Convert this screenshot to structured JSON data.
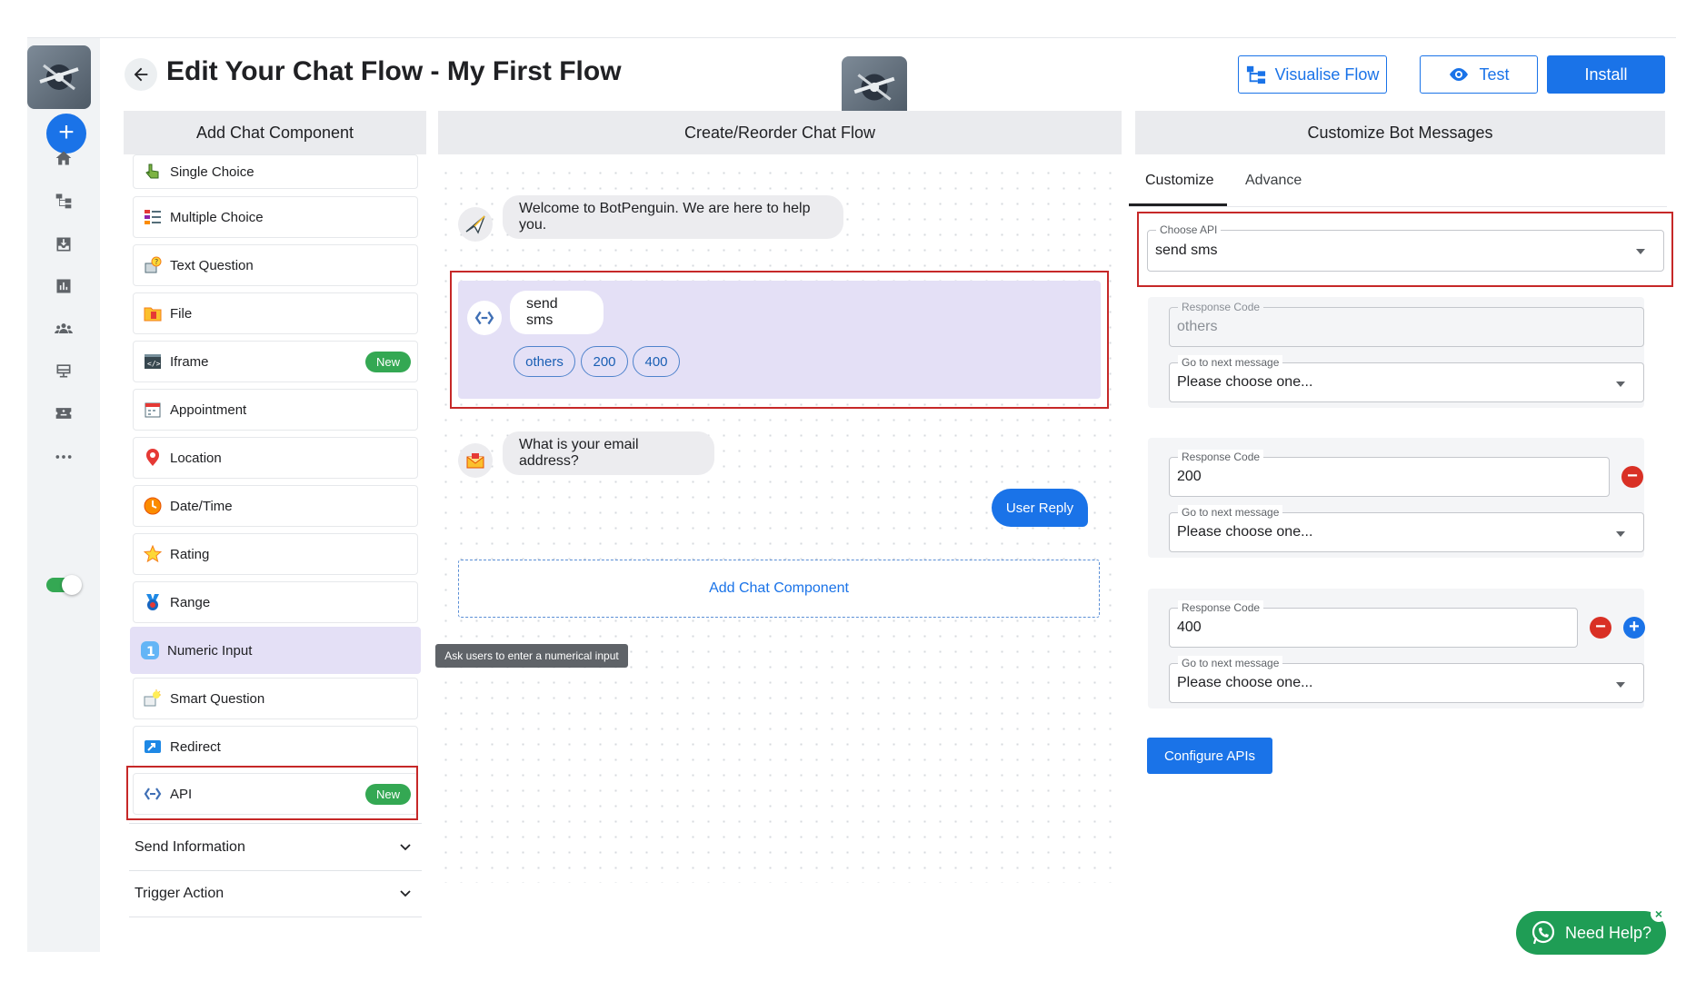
{
  "header": {
    "title": "Edit Your Chat Flow - My First Flow",
    "visualise_label": "Visualise Flow",
    "test_label": "Test",
    "install_label": "Install"
  },
  "columns": {
    "left": "Add Chat Component",
    "center": "Create/Reorder Chat Flow",
    "right": "Customize Bot Messages"
  },
  "components": [
    {
      "label": "Single Choice",
      "icon": "hand-pointer-icon"
    },
    {
      "label": "Multiple Choice",
      "icon": "list-choice-icon"
    },
    {
      "label": "Text Question",
      "icon": "question-bubble-icon"
    },
    {
      "label": "File",
      "icon": "file-folder-icon"
    },
    {
      "label": "Iframe",
      "icon": "code-window-icon",
      "badge": "New"
    },
    {
      "label": "Appointment",
      "icon": "calendar-icon"
    },
    {
      "label": "Location",
      "icon": "map-pin-icon"
    },
    {
      "label": "Date/Time",
      "icon": "clock-icon"
    },
    {
      "label": "Rating",
      "icon": "star-icon"
    },
    {
      "label": "Range",
      "icon": "range-medal-icon"
    },
    {
      "label": "Numeric Input",
      "icon": "number-one-icon"
    },
    {
      "label": "Smart Question",
      "icon": "smart-question-icon"
    },
    {
      "label": "Redirect",
      "icon": "redirect-arrow-icon"
    },
    {
      "label": "API",
      "icon": "api-brackets-icon",
      "badge": "New"
    }
  ],
  "accordions": [
    {
      "label": "Send Information"
    },
    {
      "label": "Trigger Action"
    }
  ],
  "flow": {
    "welcome": "Welcome to BotPenguin. We are here to help you.",
    "api_message": "send sms",
    "chips": [
      "others",
      "200",
      "400"
    ],
    "email_question": "What is your email address?",
    "user_reply": "User Reply",
    "add_component": "Add Chat Component",
    "tooltip": "Ask users to enter a numerical input"
  },
  "right_panel": {
    "tabs": [
      "Customize",
      "Advance"
    ],
    "choose_api_label": "Choose API",
    "choose_api_value": "send sms",
    "response_code_label": "Response Code",
    "next_message_label": "Go to next message",
    "next_message_value": "Please choose one...",
    "responses": [
      {
        "code": "",
        "placeholder": "others"
      },
      {
        "code": "200"
      },
      {
        "code": "400"
      }
    ],
    "configure_label": "Configure APIs"
  },
  "help": {
    "label": "Need Help?"
  },
  "colors": {
    "primary": "#1a73e8",
    "new_badge": "#34a853",
    "highlight_box": "#c62828",
    "selected_component": "#e4e0f6",
    "help_button": "#1f9d55"
  }
}
